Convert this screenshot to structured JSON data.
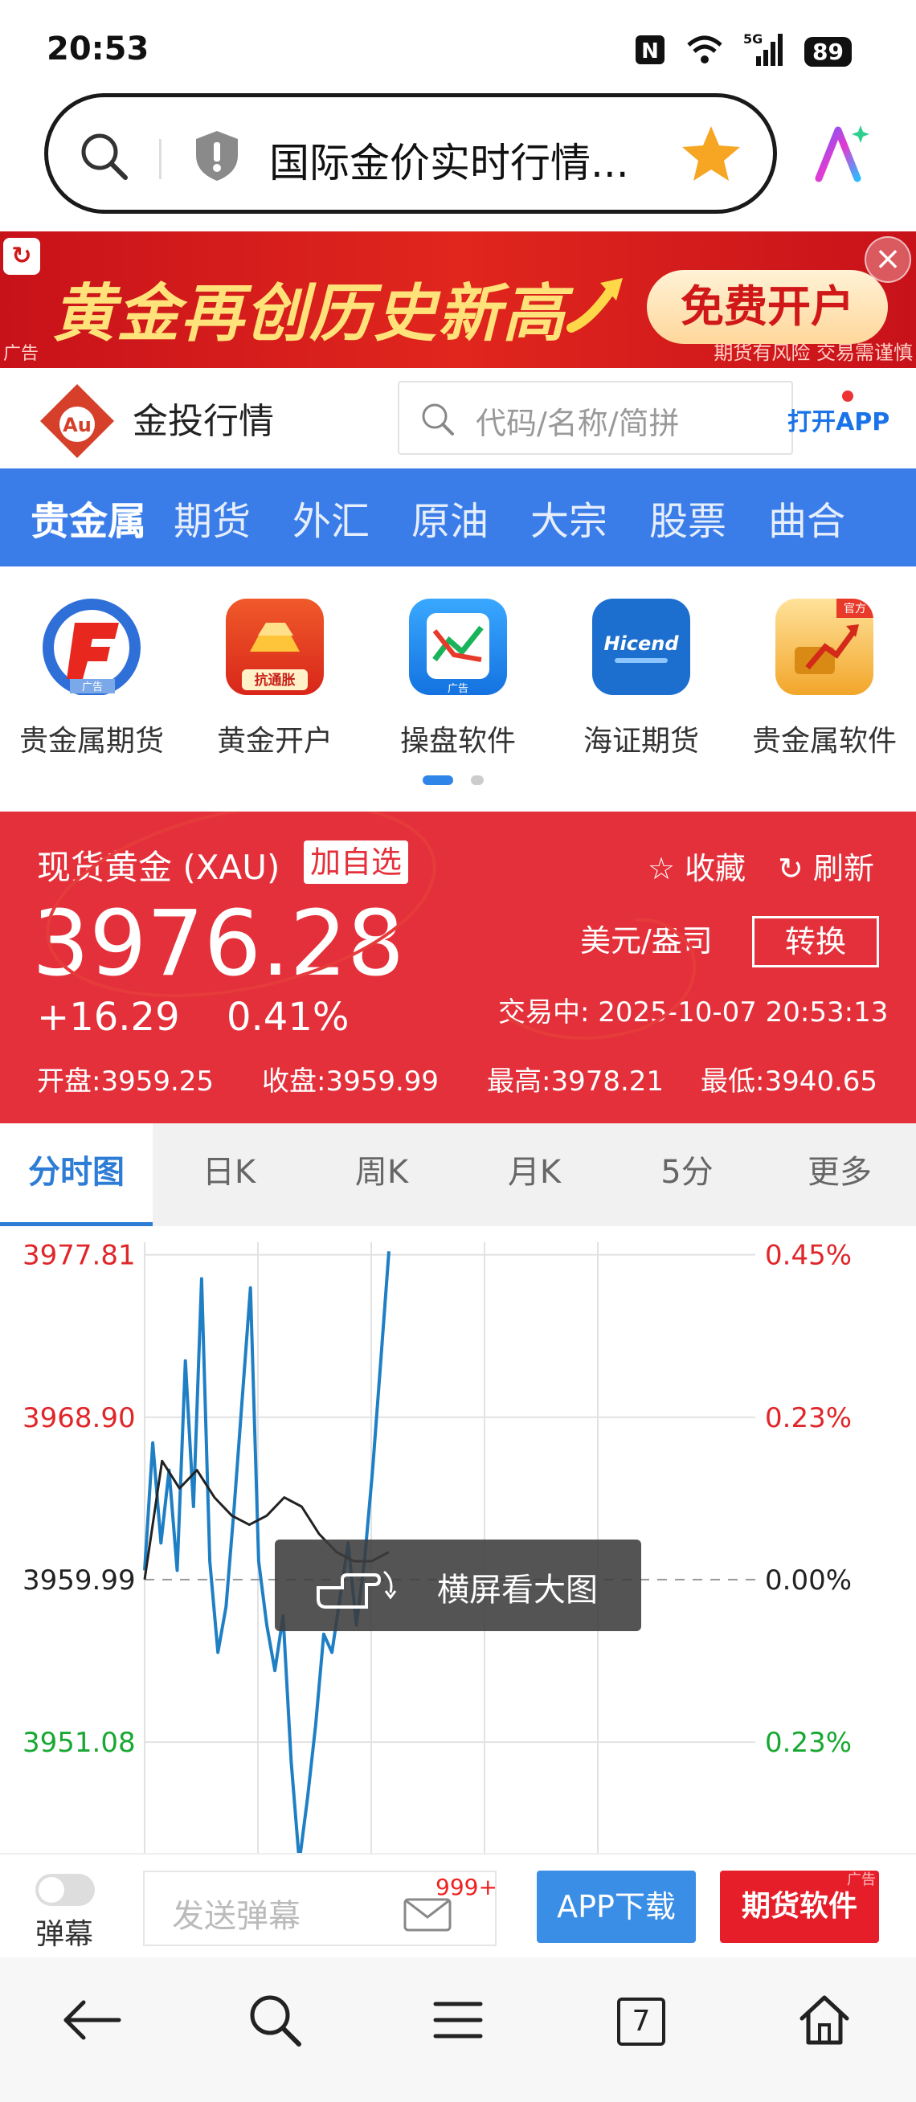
{
  "status_bar": {
    "time": "20:53",
    "network": "5G",
    "battery": "89",
    "nfc_label": "N"
  },
  "address_bar": {
    "url_title": "国际金价实时行情..."
  },
  "ad_banner": {
    "headline": "黄金再创历史新高",
    "cta": "免费开户",
    "ad_tag": "广告",
    "risk_notice": "期货有风险 交易需谨慎",
    "close_symbol": "×"
  },
  "site_header": {
    "logo_text": "Au",
    "site_name": "金投行情",
    "search_placeholder": "代码/名称/简拼",
    "open_app": "打开APP"
  },
  "category_nav": {
    "items": [
      "贵金属",
      "期货",
      "外汇",
      "原油",
      "大宗",
      "股票",
      "曲合"
    ]
  },
  "app_icons": [
    {
      "label": "贵金属期货",
      "tag": "广告",
      "color": "#2f6fd8"
    },
    {
      "label": "黄金开户",
      "tag": "抗通胀",
      "color": "#e43a1e"
    },
    {
      "label": "操盘软件",
      "tag": "广告",
      "color": "#1e8fe8"
    },
    {
      "label": "海证期货",
      "tag": "Hicend",
      "color": "#1d6fcf"
    },
    {
      "label": "贵金属软件",
      "tag": "官方",
      "color": "#f4b335"
    }
  ],
  "quote": {
    "name": "现货黄金 (XAU)",
    "add_watch": "加自选",
    "favorite": "收藏",
    "refresh": "刷新",
    "price": "3976.28",
    "unit": "美元/盎司",
    "convert": "转换",
    "change": "+16.29",
    "change_pct": "0.41%",
    "trade_status": "交易中: 2025-10-07 20:53:13",
    "open": "开盘:3959.25",
    "close": "收盘:3959.99",
    "high": "最高:3978.21",
    "low": "最低:3940.65"
  },
  "chart_tabs": [
    "分时图",
    "日K",
    "周K",
    "月K",
    "5分",
    "更多"
  ],
  "chart_data": {
    "type": "line",
    "y_left_ticks": [
      "3977.81",
      "3968.90",
      "3959.99",
      "3951.08"
    ],
    "y_right_ticks": [
      "0.45%",
      "0.23%",
      "0.00%",
      "0.23%"
    ],
    "ylim": [
      3945,
      3978.5
    ],
    "baseline": 3959.99,
    "series": [
      {
        "color": "#1f7fc4",
        "values": [
          3960.5,
          3967.5,
          3962.0,
          3966.0,
          3960.5,
          3972.0,
          3964.0,
          3976.5,
          3961.0,
          3956.0,
          3958.5,
          3964.0,
          3970.0,
          3976.0,
          3961.0,
          3957.5,
          3955.0,
          3958.0,
          3950.0,
          3944.5,
          3948.0,
          3952.0,
          3957.0,
          3956.0,
          3959.0,
          3962.0,
          3957.5,
          3961.0,
          3966.0,
          3972.0,
          3978.0
        ]
      },
      {
        "color": "#222222",
        "values": [
          3960.0,
          3966.5,
          3965.0,
          3966.0,
          3964.5,
          3963.5,
          3963.0,
          3963.5,
          3964.5,
          3964.0,
          3962.5,
          3961.5,
          3961.0,
          3961.0,
          3961.5
        ]
      }
    ],
    "overlay_text": "横屏看大图"
  },
  "bottom_bar": {
    "danmu_label": "弹幕",
    "send_placeholder": "发送弹幕",
    "badge": "999+",
    "app_download": "APP下载",
    "futures_software": "期货软件",
    "ad_tag": "广告"
  },
  "browser_nav": {
    "tab_count": "7"
  }
}
